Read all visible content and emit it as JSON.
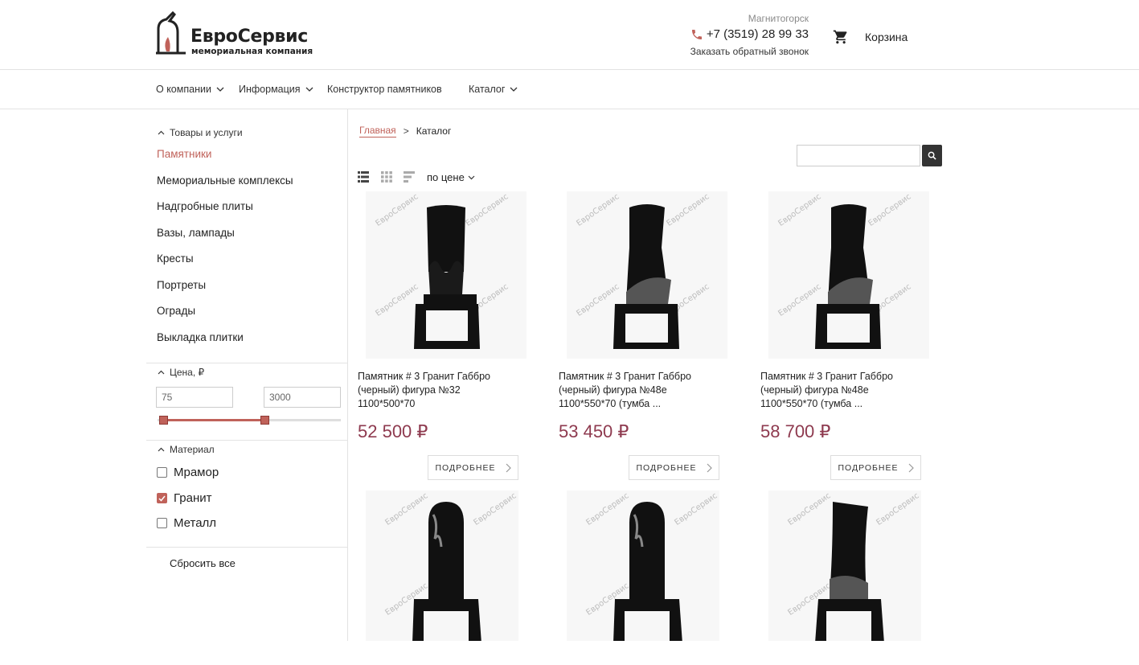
{
  "header": {
    "logo_title": "ЕвроСервис",
    "logo_subtitle": "мемориальная компания",
    "city": "Магнитогорск",
    "phone": "+7 (3519) 28 99 33",
    "callback": "Заказать обратный звонок",
    "cart_label": "Корзина"
  },
  "nav": {
    "items": [
      {
        "label": "О компании",
        "has_dropdown": true
      },
      {
        "label": "Информация",
        "has_dropdown": true
      },
      {
        "label": "Конструктор памятников",
        "has_dropdown": false
      },
      {
        "label": "Каталог",
        "has_dropdown": true
      }
    ]
  },
  "sidebar": {
    "section_title": "Товары и услуги",
    "categories": [
      {
        "label": "Памятники",
        "active": true
      },
      {
        "label": "Мемориальные комплексы",
        "active": false
      },
      {
        "label": "Надгробные плиты",
        "active": false
      },
      {
        "label": "Вазы, лампады",
        "active": false
      },
      {
        "label": "Кресты",
        "active": false
      },
      {
        "label": "Портреты",
        "active": false
      },
      {
        "label": "Ограды",
        "active": false
      },
      {
        "label": "Выкладка плитки",
        "active": false
      }
    ],
    "price_filter": {
      "title": "Цена, ₽",
      "min_value": "75",
      "max_value": "3000",
      "slider_min_fraction": 0.0,
      "slider_max_fraction": 0.59
    },
    "material_filter": {
      "title": "Материал",
      "options": [
        {
          "label": "Мрамор",
          "checked": false
        },
        {
          "label": "Гранит",
          "checked": true
        },
        {
          "label": "Металл",
          "checked": false
        }
      ]
    },
    "reset_label": "Сбросить все"
  },
  "breadcrumb": {
    "home": "Главная",
    "separator": ">",
    "current": "Каталог"
  },
  "search": {
    "placeholder": ""
  },
  "toolbar": {
    "sort_label": "по цене"
  },
  "products": [
    {
      "name": "Памятник # 3 Гранит Габбро (черный) фигура №32 1100*500*70",
      "price": "52 500 ₽",
      "button": "ПОДРОБНЕЕ",
      "watermark": "ЕвроСервис"
    },
    {
      "name": "Памятник # 3 Гранит Габбро (черный) фигура №48е 1100*550*70 (тумба ...",
      "price": "53 450 ₽",
      "button": "ПОДРОБНЕЕ",
      "watermark": "ЕвроСервис"
    },
    {
      "name": "Памятник # 3 Гранит Габбро (черный) фигура №48е 1100*550*70 (тумба ...",
      "price": "58 700 ₽",
      "button": "ПОДРОБНЕЕ",
      "watermark": "ЕвроСервис"
    },
    {
      "watermark": "ЕвроСервис"
    },
    {
      "watermark": "ЕвроСервис"
    },
    {
      "watermark": "ЕвроСервис"
    }
  ],
  "colors": {
    "accent": "#c0625a",
    "price": "#8e3a4f",
    "text": "#222222",
    "border": "#e3e3e3"
  }
}
